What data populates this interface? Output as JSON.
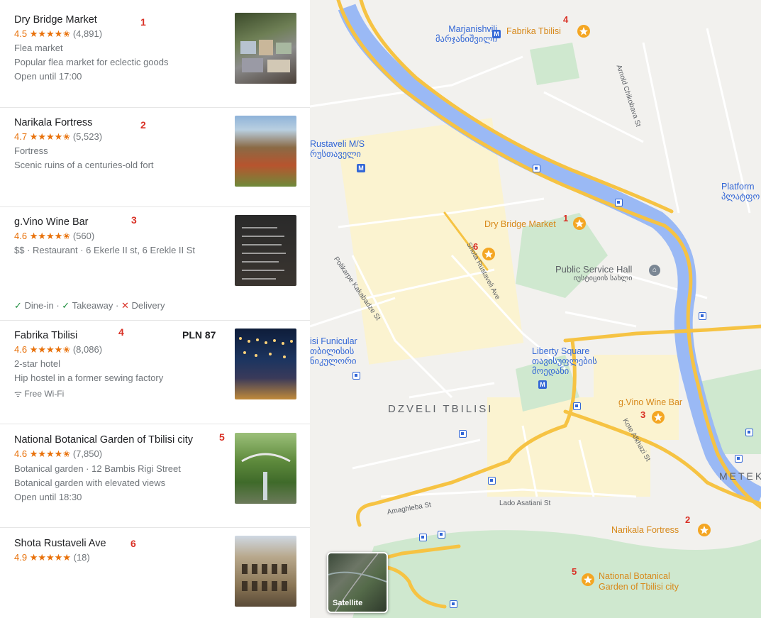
{
  "list": {
    "items": [
      {
        "title": "Dry Bridge Market",
        "num": "1",
        "rating": "4.5",
        "stars": "★★★★✬",
        "count": "(4,891)",
        "lines": [
          "Flea market",
          "Popular flea market for eclectic goods",
          "Open until 17:00"
        ]
      },
      {
        "title": "Narikala Fortress",
        "num": "2",
        "rating": "4.7",
        "stars": "★★★★✬",
        "count": "(5,523)",
        "lines": [
          "Fortress",
          "Scenic ruins of a centuries-old fort"
        ]
      },
      {
        "title": "g.Vino Wine Bar",
        "num": "3",
        "rating": "4.6",
        "stars": "★★★★✬",
        "count": "(560)",
        "lines": [
          "$$ · Restaurant · 6 Ekerle II st, 6 Erekle II St"
        ],
        "service": {
          "dine_in": "Dine-in ·",
          "takeaway": "Takeaway ·",
          "delivery": "Delivery"
        }
      },
      {
        "title": "Fabrika Tbilisi",
        "num": "4",
        "price": "PLN 87",
        "rating": "4.6",
        "stars": "★★★★✬",
        "count": "(8,086)",
        "lines": [
          "2-star hotel",
          "Hip hostel in a former sewing factory"
        ],
        "wifi": "Free Wi-Fi"
      },
      {
        "title": "National Botanical Garden of Tbilisi city",
        "num": "5",
        "rating": "4.6",
        "stars": "★★★★✬",
        "count": "(7,850)",
        "lines": [
          "Botanical garden · 12 Bambis Rigi Street",
          "Botanical garden with elevated views",
          "Open until 18:30"
        ]
      },
      {
        "title": "Shota Rustaveli Ave",
        "num": "6",
        "rating": "4.9",
        "stars": "★★★★★",
        "count": "(18)",
        "lines": []
      }
    ]
  },
  "map": {
    "district": "DZVELI TBILISI",
    "district_right": "METEK",
    "stations": [
      {
        "line1": "Marjanishvili",
        "line2": "მარჯანიშვილი"
      },
      {
        "line1": "Rustaveli M/S",
        "line2": "რუსთაველი"
      },
      {
        "line1": "Liberty Square",
        "line2": "თავისუფლების",
        "line3": "მოედანი"
      },
      {
        "line1": "Platform",
        "line2": "პლატფო"
      },
      {
        "line1": "isi Funicular",
        "line2": "თბილისის",
        "line3": "ნიკულორი"
      }
    ],
    "public_service": {
      "line1": "Public Service Hall",
      "line2": "იუსტიციის სახლი"
    },
    "places": [
      {
        "num": "1",
        "label": "Dry Bridge Market"
      },
      {
        "num": "2",
        "label": "Narikala Fortress"
      },
      {
        "num": "3",
        "label": "g.Vino Wine Bar"
      },
      {
        "num": "4",
        "label": "Fabrika Tbilisi"
      },
      {
        "num": "5",
        "label": "National Botanical",
        "label2": "Garden of Tbilisi city"
      },
      {
        "num": "6",
        "label": ""
      }
    ],
    "streets": {
      "amaghleba": "Amaghleba St",
      "lado": "Lado Asatiani St",
      "shota": "Shota Rustaveli Ave",
      "polikarpe": "Polikarpe Kakabadze St",
      "arnold": "Arnold Chikobava St",
      "kote": "Kote Afkhazi St"
    },
    "satellite_label": "Satellite"
  },
  "colors": {
    "accent_red": "#d93025",
    "star": "#e8710a",
    "river": "#9ab9f5",
    "road": "#f6c343",
    "park": "#c8e6c9",
    "water_label": "#3367d6"
  }
}
